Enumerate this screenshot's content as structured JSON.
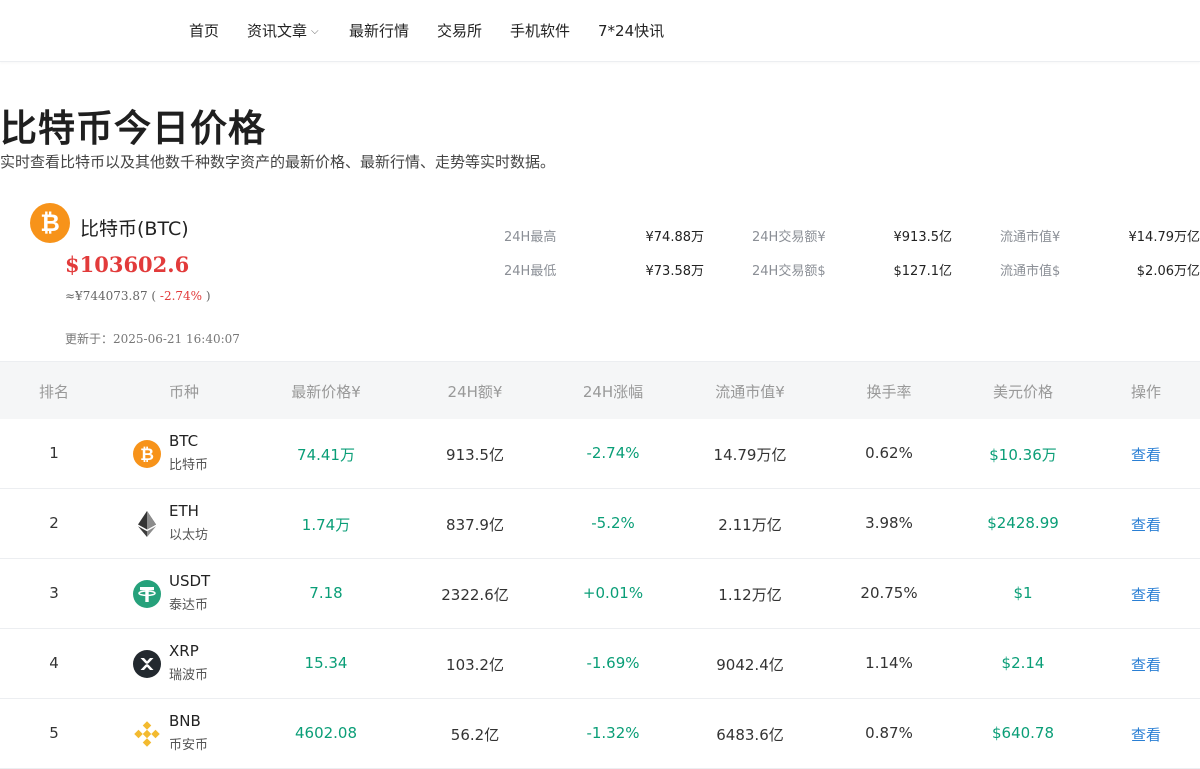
{
  "nav": {
    "items": [
      "首页",
      "资讯文章",
      "最新行情",
      "交易所",
      "手机软件",
      "7*24快讯"
    ],
    "dropdown_indicator": "⌵"
  },
  "page": {
    "title": "比特币今日价格",
    "subtitle": "实时查看比特币以及其他数千种数字资产的最新价格、最新行情、走势等实时数据。"
  },
  "coin": {
    "name": "比特币(BTC)",
    "usd_price": "$103602.6",
    "cny_price": "≈¥744073.87",
    "change": "-2.74%",
    "updated": "更新于：2025-06-21 16:40:07",
    "stats": [
      {
        "label": "24H最高",
        "value": "¥74.88万"
      },
      {
        "label": "24H交易额¥",
        "value": "¥913.5亿"
      },
      {
        "label": "流通市值¥",
        "value": "¥14.79万亿"
      },
      {
        "label": "24H最低",
        "value": "¥73.58万"
      },
      {
        "label": "24H交易额$",
        "value": "$127.1亿"
      },
      {
        "label": "流通市值$",
        "value": "$2.06万亿"
      }
    ]
  },
  "table": {
    "headers": [
      "排名",
      "币种",
      "最新价格¥",
      "24H额¥",
      "24H涨幅",
      "流通市值¥",
      "换手率",
      "美元价格",
      "操作"
    ],
    "rows": [
      {
        "rank": "1",
        "symbol": "BTC",
        "name": "比特币",
        "icon": "bitcoin-icon",
        "price": "74.41万",
        "volume": "913.5亿",
        "change": "-2.74%",
        "market_cap": "14.79万亿",
        "turnover": "0.62%",
        "usd": "$10.36万",
        "action": "查看"
      },
      {
        "rank": "2",
        "symbol": "ETH",
        "name": "以太坊",
        "icon": "ethereum-icon",
        "price": "1.74万",
        "volume": "837.9亿",
        "change": "-5.2%",
        "market_cap": "2.11万亿",
        "turnover": "3.98%",
        "usd": "$2428.99",
        "action": "查看"
      },
      {
        "rank": "3",
        "symbol": "USDT",
        "name": "泰达币",
        "icon": "tether-icon",
        "price": "7.18",
        "volume": "2322.6亿",
        "change": "+0.01%",
        "market_cap": "1.12万亿",
        "turnover": "20.75%",
        "usd": "$1",
        "action": "查看"
      },
      {
        "rank": "4",
        "symbol": "XRP",
        "name": "瑞波币",
        "icon": "xrp-icon",
        "price": "15.34",
        "volume": "103.2亿",
        "change": "-1.69%",
        "market_cap": "9042.4亿",
        "turnover": "1.14%",
        "usd": "$2.14",
        "action": "查看"
      },
      {
        "rank": "5",
        "symbol": "BNB",
        "name": "币安币",
        "icon": "bnb-icon",
        "price": "4602.08",
        "volume": "56.2亿",
        "change": "-1.32%",
        "market_cap": "6483.6亿",
        "turnover": "0.87%",
        "usd": "$640.78",
        "action": "查看"
      }
    ]
  },
  "colors": {
    "negative": "#e23b3b",
    "positive": "#0a9e77",
    "link": "#2a7fd4",
    "bitcoin": "#f7931a",
    "tether": "#26a17b",
    "bnb": "#f3ba2f"
  }
}
